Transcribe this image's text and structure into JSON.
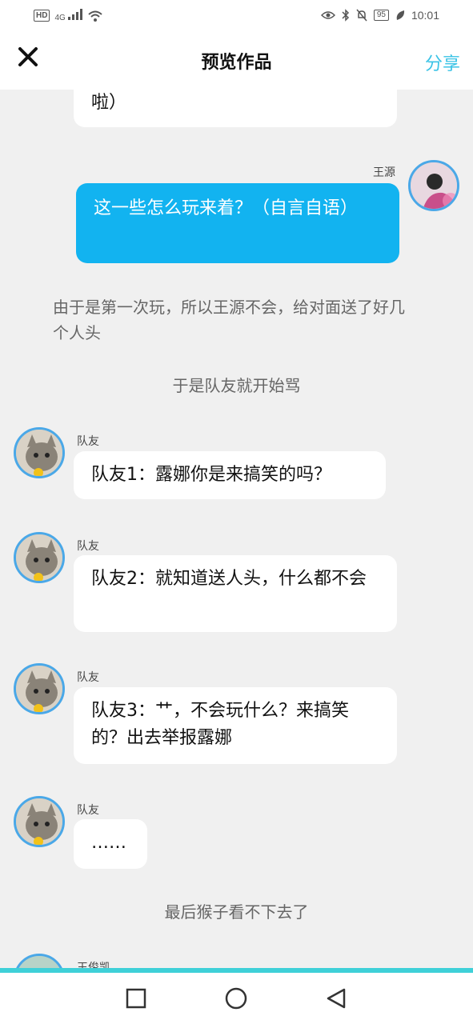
{
  "status_bar": {
    "network_badge": "HD",
    "signal": "4G",
    "battery": "95",
    "time": "10:01"
  },
  "header": {
    "title": "预览作品",
    "share_label": "分享"
  },
  "messages": {
    "top_partial": "啦）",
    "wangyuan_name": "王源",
    "wangyuan_text": "这一些怎么玩来着？（自言自语）",
    "narration1": "由于是第一次玩，所以王源不会，给对面送了好几个人头",
    "narration2": "于是队友就开始骂",
    "teammate_name": "队友",
    "tm1": "队友1：露娜你是来搞笑的吗？",
    "tm2": "队友2：就知道送人头，什么都不会",
    "tm3": "队友3：艹，不会玩什么？来搞笑的？出去举报露娜",
    "tm4": "……",
    "narration3": "最后猴子看不下去了",
    "last_name": "王俊凯"
  },
  "colors": {
    "accent": "#3bc3e6",
    "bubble_blue": "#12b3f0",
    "avatar_border": "#4aa8e8"
  }
}
